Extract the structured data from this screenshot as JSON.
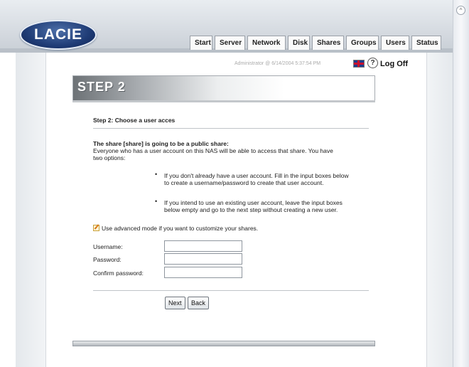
{
  "header": {
    "logo_text": "LACIE",
    "tabs": [
      "Start",
      "Server",
      "Network",
      "Disk",
      "Shares",
      "Groups",
      "Users",
      "Status"
    ]
  },
  "status": {
    "user_line": "Administrator @ 6/14/2004 5:37:54 PM",
    "logoff": "Log Off",
    "help_glyph": "?"
  },
  "step": {
    "title": "STEP 2",
    "subtitle": "Step 2: Choose a user acces"
  },
  "body": {
    "heading": "The share [share] is going to be a public share:",
    "intro_line1": "Everyone who has a user account on this NAS will be able to access that share. You have",
    "intro_line2": "two options:",
    "bullet1_line1": "If you don't already have a user account. Fill in the input boxes below",
    "bullet1_line2": "to create a username/password to create that user account.",
    "bullet2_line1": "If you intend to use an existing user account, leave the input boxes",
    "bullet2_line2": "below empty and go to the next step without creating a new user.",
    "advanced": "Use advanced mode if you want to customize your shares."
  },
  "form": {
    "username_label": "Username:",
    "password_label": "Password:",
    "confirm_label": "Confirm password:",
    "username_value": "",
    "password_value": "",
    "confirm_value": ""
  },
  "buttons": {
    "next": "Next",
    "back": "Back"
  },
  "icons": {
    "flag": "uk-flag-icon",
    "help": "help-icon",
    "advanced": "edit-icon"
  }
}
